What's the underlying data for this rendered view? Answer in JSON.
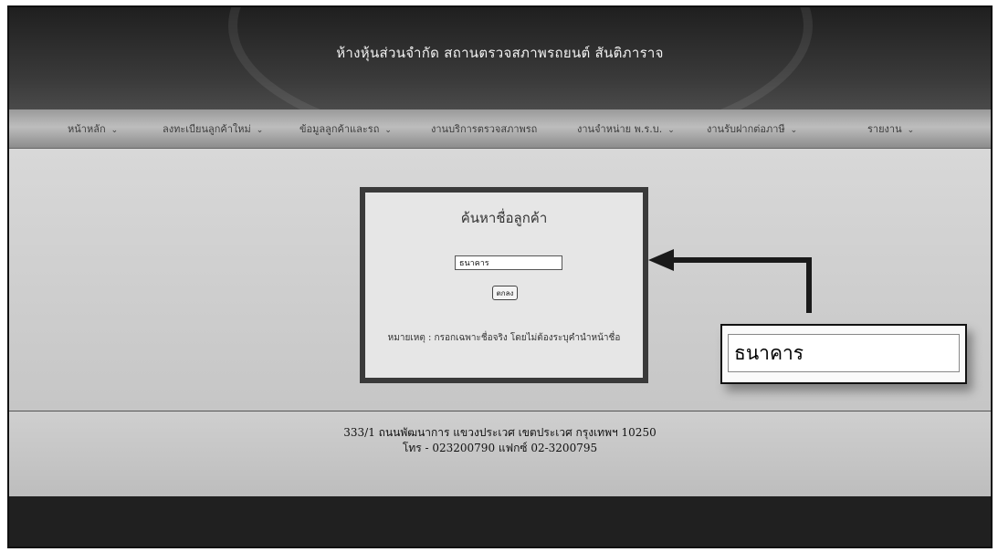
{
  "site": {
    "title": "ห้างหุ้นส่วนจำกัด สถานตรวจสภาพรถยนต์ สันติภาราจ"
  },
  "nav": {
    "items": [
      {
        "label": "หน้าหลัก",
        "icon": "chevron-down-icon"
      },
      {
        "label": "ลงทะเบียนลูกค้าใหม่",
        "icon": "chevron-down-icon"
      },
      {
        "label": "ข้อมูลลูกค้าและรถ",
        "icon": "chevron-down-icon"
      },
      {
        "label": "งานบริการตรวจสภาพรถ",
        "icon": ""
      },
      {
        "label": "งานจำหน่าย พ.ร.บ.",
        "icon": "chevron-down-icon"
      },
      {
        "label": "งานรับฝากต่อภาษี",
        "icon": "chevron-down-icon"
      },
      {
        "label": "รายงาน",
        "icon": "chevron-down-icon"
      }
    ]
  },
  "search": {
    "title": "ค้นหาชื่อลูกค้า",
    "value": "ธนาคาร",
    "button": "ตกลง",
    "note": "หมายเหตุ : กรอกเฉพาะชื่อจริง โดยไม่ต้องระบุคำนำหน้าชื่อ"
  },
  "callout": {
    "text": "ธนาคาร"
  },
  "footer": {
    "address": "333/1 ถนนพัฒนาการ แขวงประเวศ เขตประเวศ กรุงเทพฯ 10250",
    "contact": "โทร - 023200790 แฟกซ์ 02-3200795"
  },
  "colors": {
    "header": "#2b2b2b",
    "navbar": "#aaaaaa",
    "content": "#d0d0d0",
    "box_border": "#3a3a3a"
  }
}
